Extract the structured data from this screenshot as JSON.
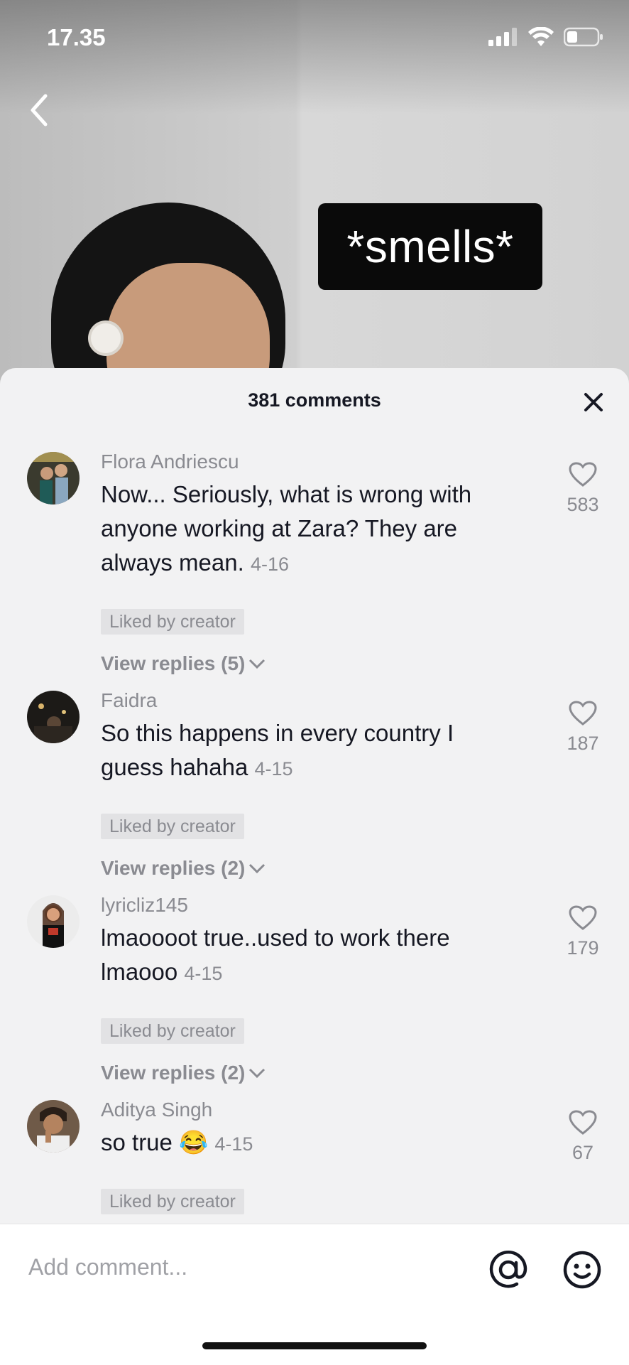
{
  "status": {
    "time": "17.35"
  },
  "video": {
    "caption": "*smells*"
  },
  "comments_panel": {
    "title": "381 comments",
    "comments": [
      {
        "user": "Flora Andriescu",
        "text": "Now... Seriously, what is wrong with anyone working at Zara? They are always mean.",
        "date": "4-16",
        "likes": "583",
        "liked_by_creator": "Liked by creator",
        "replies": "View replies (5)"
      },
      {
        "user": "Faidra",
        "text": "So this happens in every country I guess hahaha",
        "date": "4-15",
        "likes": "187",
        "liked_by_creator": "Liked by creator",
        "replies": "View replies (2)"
      },
      {
        "user": "lyricliz145",
        "text": "lmaoooot true..used to work there lmaooo",
        "date": "4-15",
        "likes": "179",
        "liked_by_creator": "Liked by creator",
        "replies": "View replies (2)"
      },
      {
        "user": "Aditya Singh",
        "text": "so true 😂",
        "date": "4-15",
        "likes": "67",
        "liked_by_creator": "Liked by creator"
      }
    ]
  },
  "input": {
    "placeholder": "Add comment..."
  }
}
